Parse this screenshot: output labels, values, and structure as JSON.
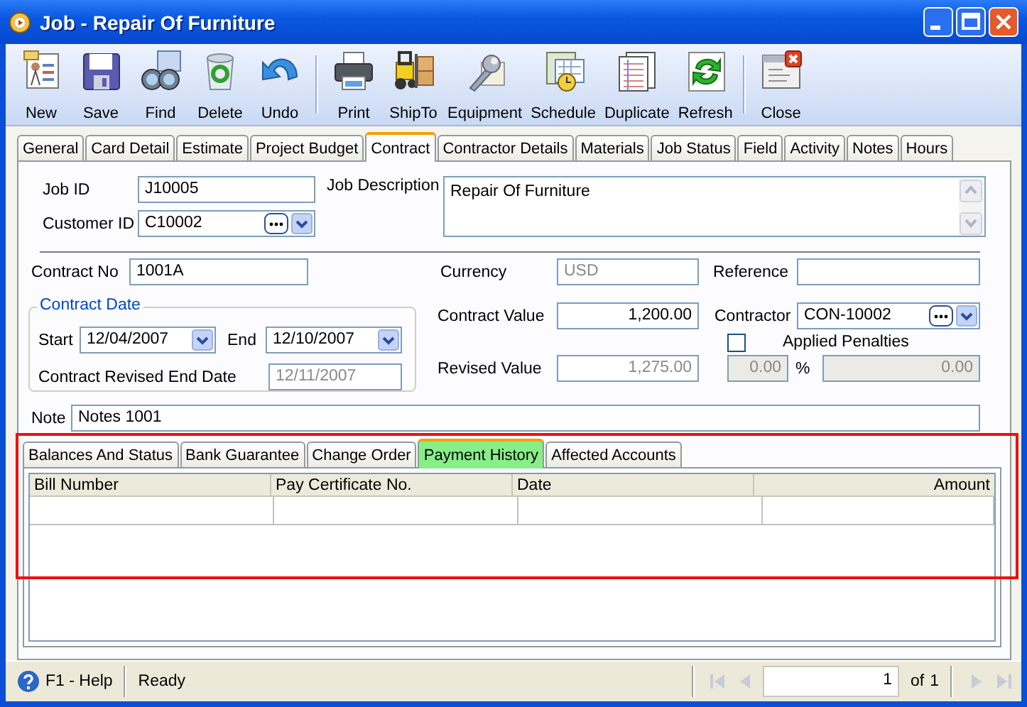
{
  "window": {
    "title": "Job - Repair Of Furniture"
  },
  "toolbar_groups": [
    [
      {
        "label": "New"
      },
      {
        "label": "Save"
      },
      {
        "label": "Find"
      },
      {
        "label": "Delete"
      },
      {
        "label": "Undo"
      }
    ],
    [
      {
        "label": "Print"
      },
      {
        "label": "ShipTo"
      },
      {
        "label": "Equipment"
      },
      {
        "label": "Schedule"
      },
      {
        "label": "Duplicate"
      },
      {
        "label": "Refresh"
      }
    ],
    [
      {
        "label": "Close"
      }
    ]
  ],
  "tabs": [
    {
      "label": "General",
      "selected": false
    },
    {
      "label": "Card Detail",
      "selected": false
    },
    {
      "label": "Estimate",
      "selected": false
    },
    {
      "label": "Project Budget",
      "selected": false
    },
    {
      "label": "Contract",
      "selected": true
    },
    {
      "label": "Contractor Details",
      "selected": false
    },
    {
      "label": "Materials",
      "selected": false
    },
    {
      "label": "Job Status",
      "selected": false
    },
    {
      "label": "Field",
      "selected": false
    },
    {
      "label": "Activity",
      "selected": false
    },
    {
      "label": "Notes",
      "selected": false
    },
    {
      "label": "Hours",
      "selected": false
    }
  ],
  "job": {
    "job_id": {
      "label": "Job ID",
      "value": "J10005"
    },
    "customer_id": {
      "label": "Customer ID",
      "value": "C10002"
    },
    "job_description": {
      "label": "Job Description",
      "value": "Repair Of Furniture"
    }
  },
  "contract": {
    "contract_no": {
      "label": "Contract No",
      "value": "1001A"
    },
    "currency": {
      "label": "Currency",
      "value": "USD",
      "disabled": true
    },
    "reference": {
      "label": "Reference"
    },
    "contract_date": {
      "legend": "Contract Date",
      "start": {
        "label": "Start",
        "value": "12/04/2007"
      },
      "end": {
        "label": "End",
        "value": "12/10/2007"
      },
      "revised_end": {
        "label": "Contract Revised End Date",
        "value": "12/11/2007",
        "disabled": true
      }
    },
    "contract_value": {
      "label": "Contract Value",
      "value": "1,200.00",
      "disabled": false
    },
    "contractor": {
      "label": "Contractor",
      "value": "CON-10002"
    },
    "applied_penalties": {
      "label": "Applied Penalties",
      "checked": false
    },
    "revised_value": {
      "label": "Revised Value",
      "value": "1,275.00",
      "disabled": true
    },
    "penalty_amount": {
      "value": "0.00",
      "disabled": true
    },
    "percent_sign": "%",
    "penalty_total": {
      "value": "0.00",
      "disabled": true
    },
    "note": {
      "label": "Note",
      "value": "Notes 1001"
    }
  },
  "sub_tabs": [
    {
      "label": "Balances And Status",
      "selected": false
    },
    {
      "label": "Bank Guarantee",
      "selected": false
    },
    {
      "label": "Change Order",
      "selected": false
    },
    {
      "label": "Payment History",
      "selected": true
    },
    {
      "label": "Affected Accounts",
      "selected": false
    }
  ],
  "grid": {
    "columns": [
      {
        "label": "Bill Number"
      },
      {
        "label": "Pay Certificate No."
      },
      {
        "label": "Date"
      },
      {
        "label": "Amount"
      }
    ]
  },
  "status_bar": {
    "help": "F1 - Help",
    "status": "Ready",
    "page": "1",
    "of": "of",
    "total": "1"
  }
}
